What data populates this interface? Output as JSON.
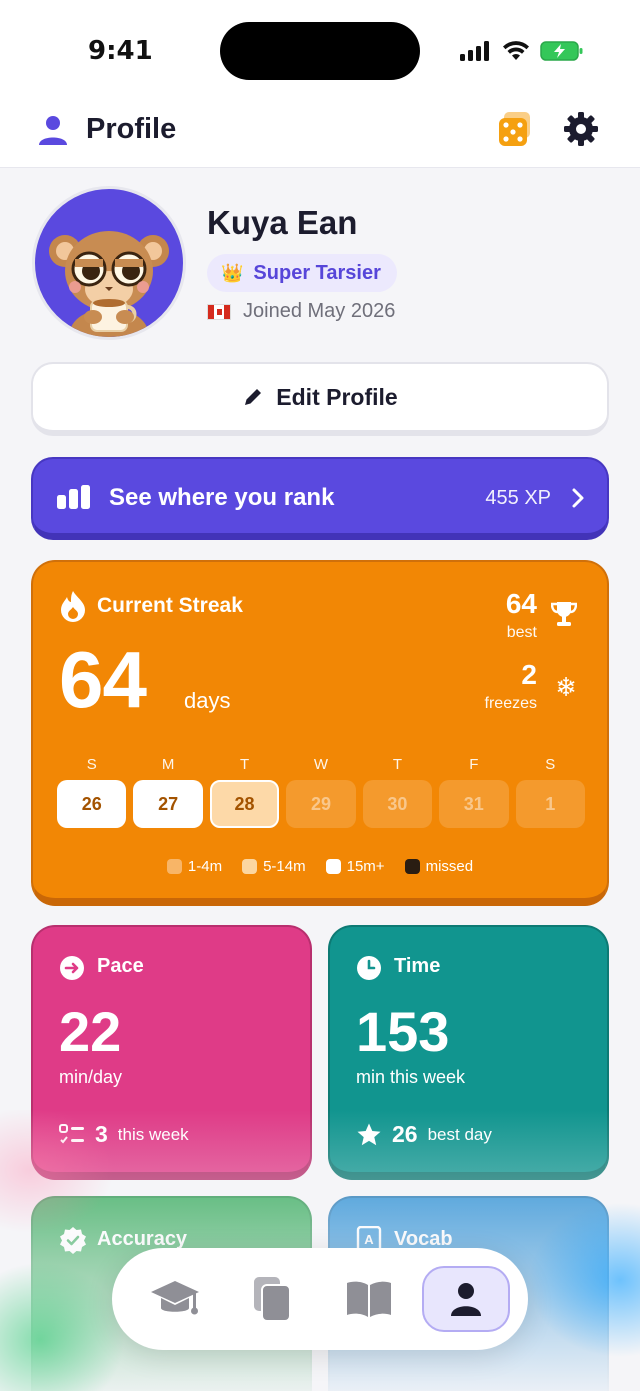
{
  "status_bar": {
    "time": "9:41"
  },
  "header": {
    "title": "Profile",
    "icons": [
      "person-icon",
      "dice-icon",
      "gear-icon"
    ]
  },
  "profile": {
    "name": "Kuya Ean",
    "badge": "Super Tarsier",
    "badge_icon": "crown-icon",
    "joined": "Joined May 2026",
    "flag": "canada-flag"
  },
  "edit_profile": {
    "label": "Edit Profile"
  },
  "rank": {
    "label": "See where you rank",
    "xp": "455 XP"
  },
  "streak": {
    "title": "Current Streak",
    "count": "64",
    "unit": "days",
    "best": "64",
    "best_label": "best",
    "freezes": "2",
    "freezes_label": "freezes",
    "days": [
      {
        "letter": "S",
        "date": "26",
        "state": "full"
      },
      {
        "letter": "M",
        "date": "27",
        "state": "full"
      },
      {
        "letter": "T",
        "date": "28",
        "state": "today"
      },
      {
        "letter": "W",
        "date": "29",
        "state": "future"
      },
      {
        "letter": "T",
        "date": "30",
        "state": "future"
      },
      {
        "letter": "F",
        "date": "31",
        "state": "future"
      },
      {
        "letter": "S",
        "date": "1",
        "state": "future"
      }
    ],
    "legend": [
      {
        "label": "1-4m",
        "color": "#f8b567"
      },
      {
        "label": "5-14m",
        "color": "#fcd6a0"
      },
      {
        "label": "15m+",
        "color": "#ffffff"
      },
      {
        "label": "missed",
        "color": "#2a1d12"
      }
    ]
  },
  "pace": {
    "title": "Pace",
    "value": "22",
    "unit": "min/day",
    "foot_value": "3",
    "foot_label": "this week"
  },
  "time_card": {
    "title": "Time",
    "value": "153",
    "unit": "min this week",
    "foot_value": "26",
    "foot_label": "best day"
  },
  "accuracy": {
    "title": "Accuracy"
  },
  "vocab": {
    "title": "Vocab"
  },
  "colors": {
    "accent": "#5a49df",
    "streak": "#f28705",
    "pace": "#df3b87",
    "time": "#11958f",
    "accuracy": "#2aa652",
    "vocab": "#1d88d2"
  },
  "tabs": [
    {
      "name": "learn",
      "icon": "graduation-cap-icon",
      "active": false
    },
    {
      "name": "cards",
      "icon": "cards-icon",
      "active": false
    },
    {
      "name": "library",
      "icon": "book-icon",
      "active": false
    },
    {
      "name": "profile",
      "icon": "person-icon",
      "active": true
    }
  ]
}
